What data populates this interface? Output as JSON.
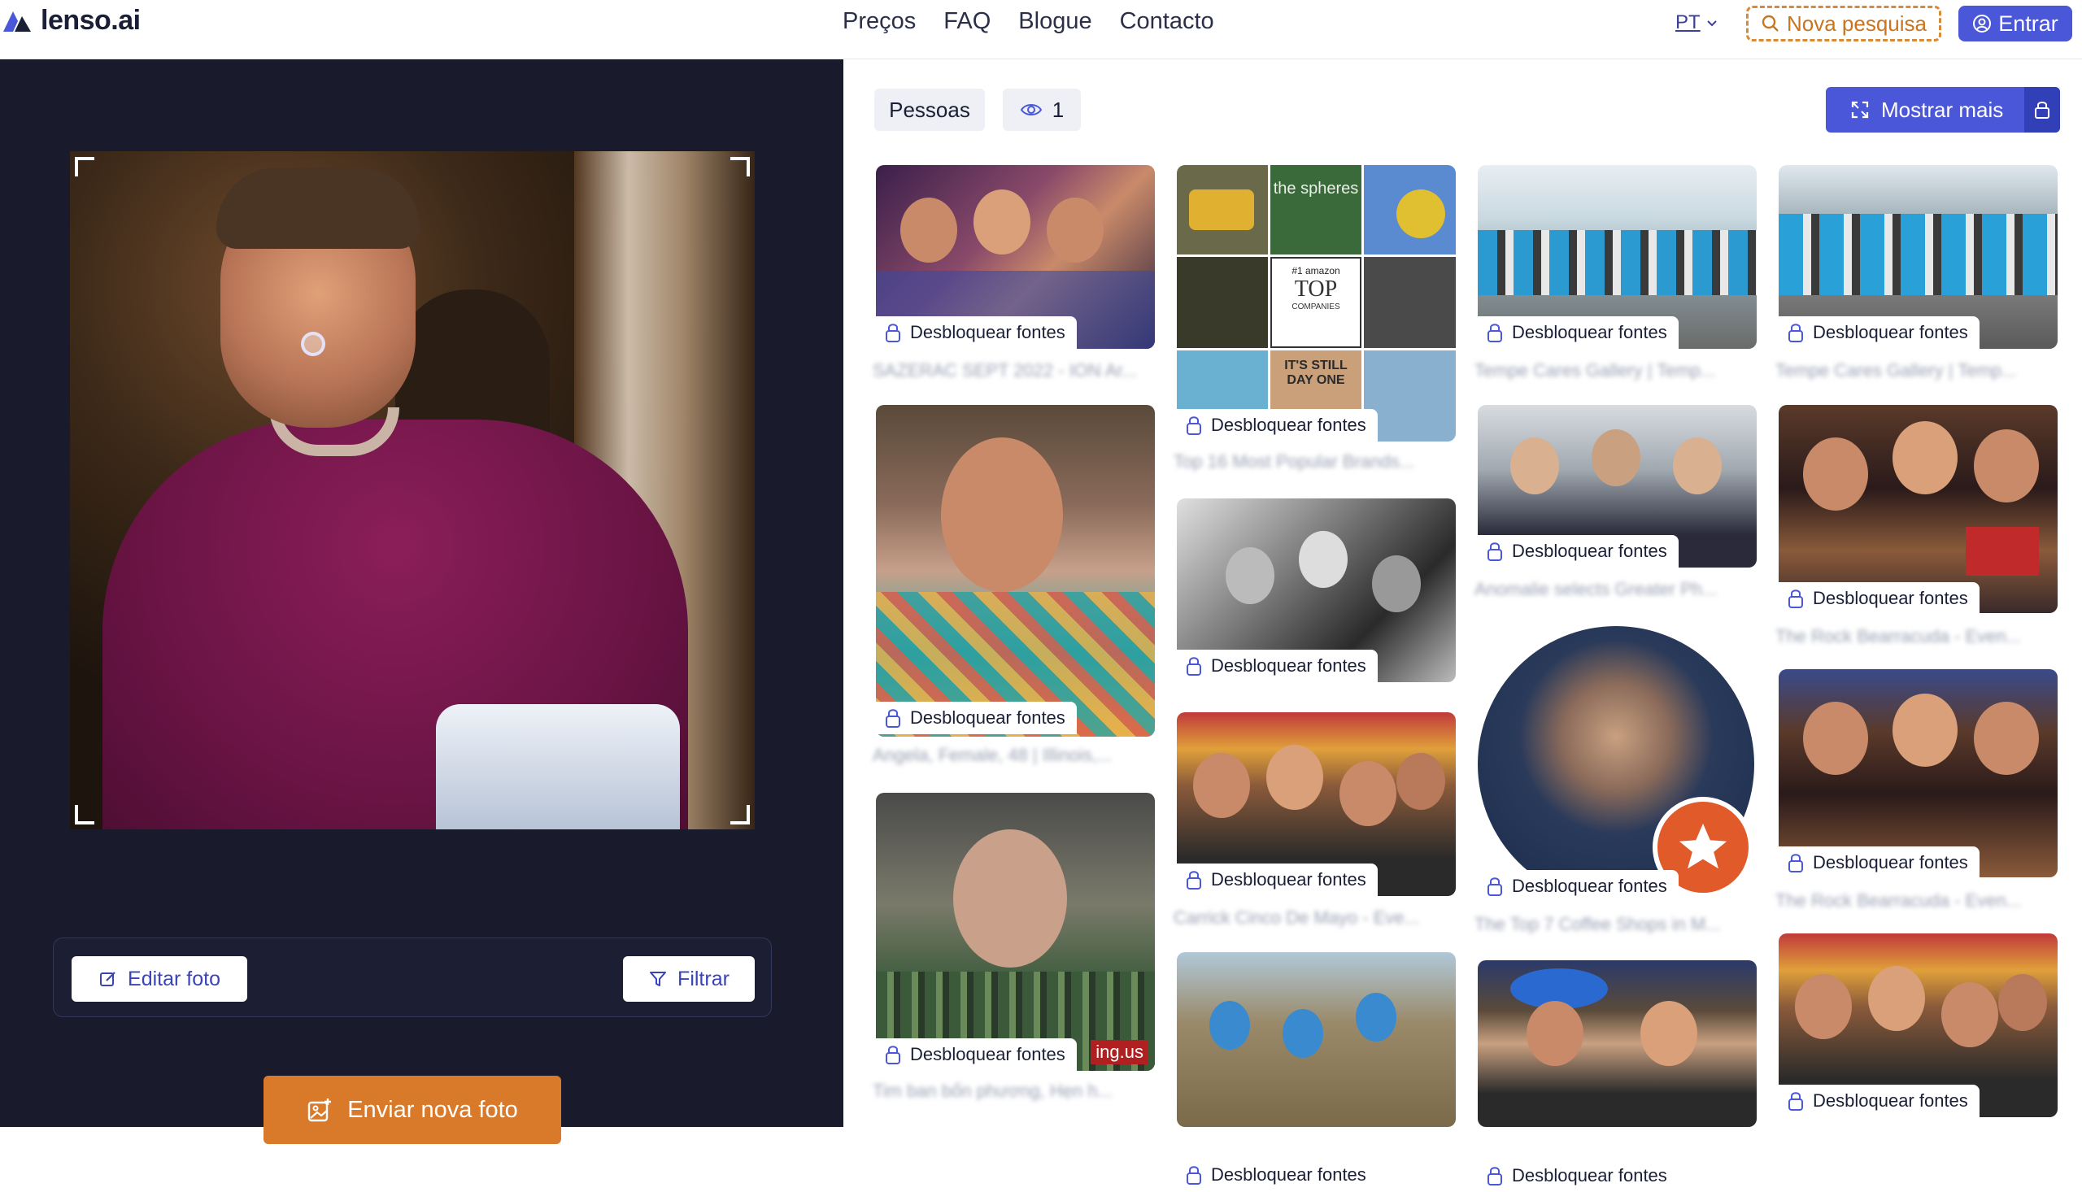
{
  "header": {
    "logo_text": "lenso.ai",
    "nav": [
      "Preços",
      "FAQ",
      "Blogue",
      "Contacto"
    ],
    "language": "PT",
    "new_search_label": "Nova pesquisa",
    "login_label": "Entrar"
  },
  "left_panel": {
    "edit_photo_label": "Editar foto",
    "filter_label": "Filtrar",
    "upload_label": "Enviar nova foto"
  },
  "results": {
    "people_label": "Pessoas",
    "views_count": "1",
    "show_more_label": "Mostrar mais",
    "unlock_label": "Desbloquear fontes",
    "cards": [
      {
        "caption": "SAZERAC SEPT 2022 - ION Ar..."
      },
      {
        "caption": "Angela, Female, 48 | Illinois,..."
      },
      {
        "caption": "Tim ban bốn phương, Hẹn h..."
      },
      {
        "caption": "Top 16 Most Popular Brands..."
      },
      {
        "caption": ""
      },
      {
        "caption": "Carrick Cinco De Mayo - Eve..."
      },
      {
        "caption": ""
      },
      {
        "caption": "Tempe Cares Gallery | Temp..."
      },
      {
        "caption": "Anomalie selects Greater Ph..."
      },
      {
        "caption": "The Top 7 Coffee Shops in M..."
      },
      {
        "caption": ""
      },
      {
        "caption": "Tempe Cares Gallery | Temp..."
      },
      {
        "caption": "The Rock Bearracuda - Even..."
      },
      {
        "caption": "The Rock Bearracuda - Even..."
      },
      {
        "caption": ""
      }
    ],
    "collage_texts": [
      "the spheres",
      "#1 amazon",
      "TOP",
      "COMPANIES",
      "IT'S STILL DAY ONE"
    ],
    "watermark": "ing.us"
  },
  "colors": {
    "brand": "#4a57d8",
    "accent_orange": "#d97a2b",
    "left_panel_bg": "#191a2b"
  }
}
